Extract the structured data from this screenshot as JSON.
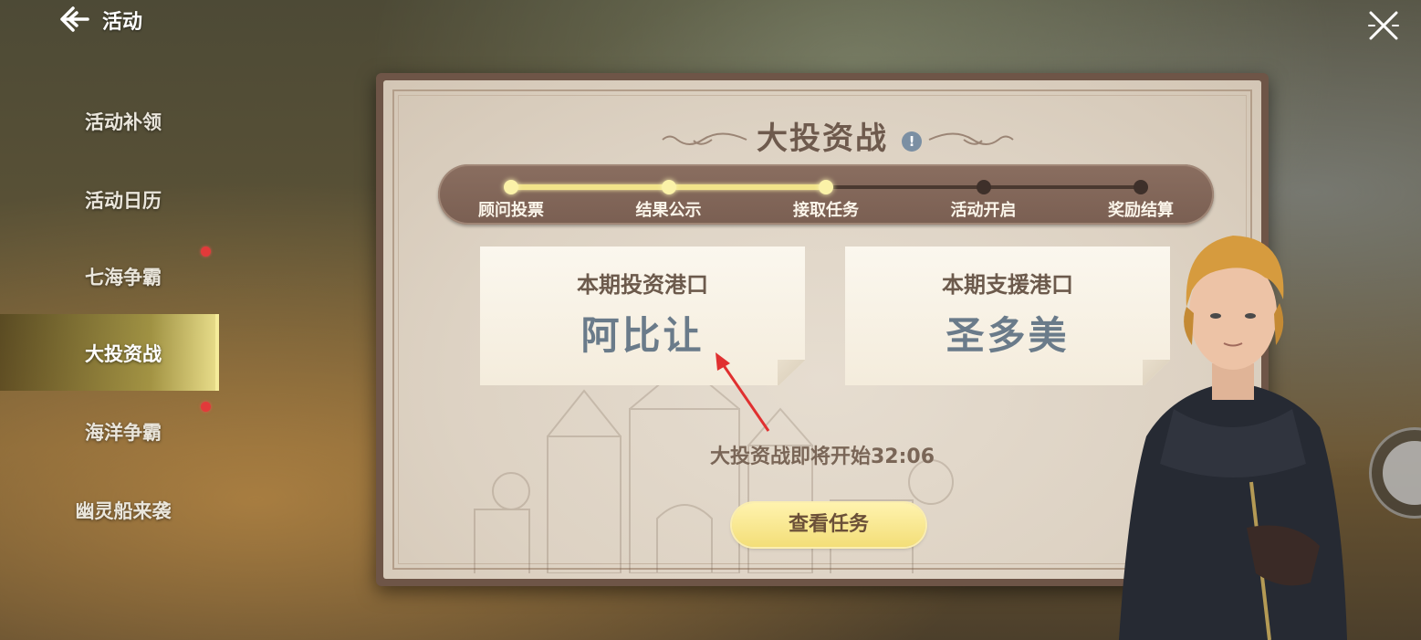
{
  "header": {
    "title": "活动"
  },
  "sidebar": {
    "items": [
      {
        "label": "活动补领",
        "badge": false
      },
      {
        "label": "活动日历",
        "badge": false
      },
      {
        "label": "七海争霸",
        "badge": true
      },
      {
        "label": "大投资战",
        "badge": false,
        "active": true
      },
      {
        "label": "海洋争霸",
        "badge": true
      },
      {
        "label": "幽灵船来袭",
        "badge": false
      }
    ]
  },
  "panel": {
    "title": "大投资战",
    "info_icon": "!",
    "progress": {
      "steps": [
        {
          "label": "顾问投票",
          "done": true
        },
        {
          "label": "结果公示",
          "done": true
        },
        {
          "label": "接取任务",
          "done": true
        },
        {
          "label": "活动开启",
          "done": false
        },
        {
          "label": "奖励结算",
          "done": false
        }
      ]
    },
    "invest_card": {
      "heading": "本期投资港口",
      "port": "阿比让"
    },
    "support_card": {
      "heading": "本期支援港口",
      "port": "圣多美"
    },
    "countdown": "大投资战即将开始32:06",
    "task_button": "查看任务"
  },
  "colors": {
    "accent_yellow": "#f2e48a",
    "badge_red": "#e23a3a",
    "port_text": "#6a7b8a",
    "panel_border": "#6e5547"
  }
}
